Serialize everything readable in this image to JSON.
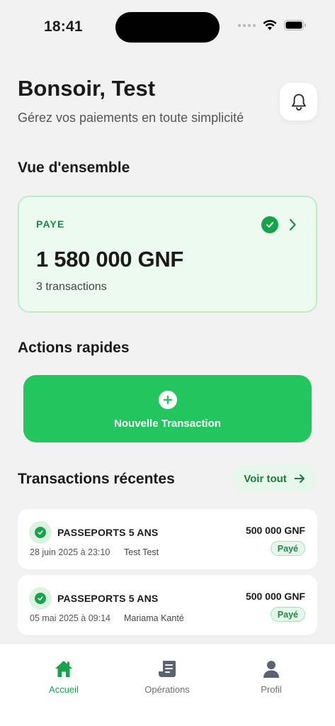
{
  "status_bar": {
    "time": "18:41"
  },
  "header": {
    "greeting": "Bonsoir, Test",
    "subtitle": "Gérez vos paiements en toute simplicité"
  },
  "overview": {
    "section_title": "Vue d'ensemble",
    "status_label": "PAYE",
    "amount": "1 580 000 GNF",
    "transactions_count": "3 transactions"
  },
  "quick_actions": {
    "section_title": "Actions rapides",
    "new_transaction_label": "Nouvelle Transaction"
  },
  "recent": {
    "section_title": "Transactions récentes",
    "see_all_label": "Voir tout",
    "items": [
      {
        "title": "PASSEPORTS 5 ANS",
        "date": "28 juin 2025 à 23:10",
        "person": "Test Test",
        "amount": "500 000 GNF",
        "status": "Payé"
      },
      {
        "title": "PASSEPORTS 5 ANS",
        "date": "05 mai 2025 à 09:14",
        "person": "Mariama Kanté",
        "amount": "500 000 GNF",
        "status": "Payé"
      }
    ]
  },
  "tab_bar": {
    "items": [
      {
        "label": "Accueil",
        "icon": "home-icon",
        "active": true
      },
      {
        "label": "Opérations",
        "icon": "operations-icon",
        "active": false
      },
      {
        "label": "Profil",
        "icon": "profile-icon",
        "active": false
      }
    ]
  },
  "colors": {
    "accent": "#22c55e",
    "accent_dark": "#16a34a",
    "card_bg": "#ecfaf0",
    "page_bg": "#f2f2f3"
  }
}
